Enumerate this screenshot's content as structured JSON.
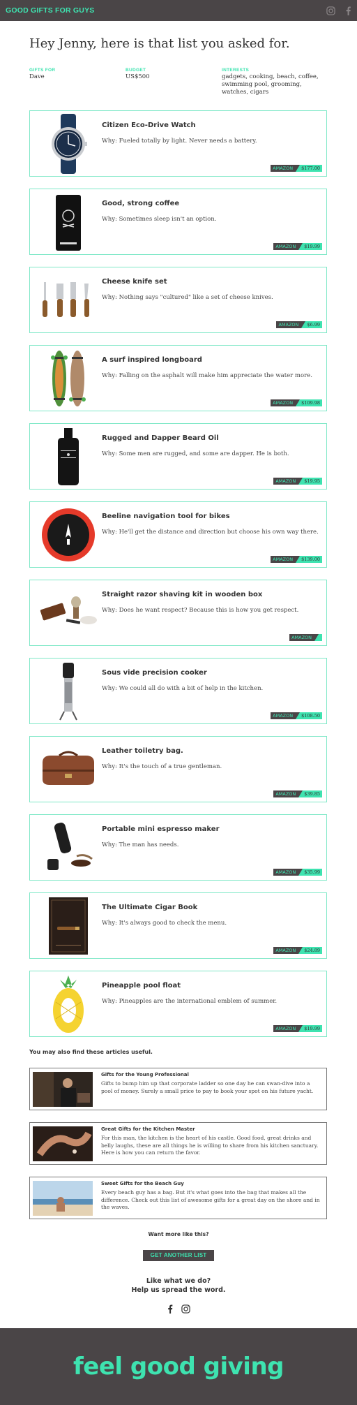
{
  "header": {
    "brand": "GOOD GIFTS FOR GUYS",
    "icons": [
      "instagram-icon",
      "facebook-icon"
    ]
  },
  "greeting": "Hey Jenny, here is that list you asked for.",
  "meta": {
    "gifts_for_label": "GIFTS FOR",
    "gifts_for_value": "Dave",
    "budget_label": "BUDGET",
    "budget_value": "US$500",
    "interests_label": "INTERESTS",
    "interests_value": "gadgets, cooking, beach, coffee, swimming pool, grooming, watches, cigars"
  },
  "items": [
    {
      "title": "Citizen Eco-Drive Watch",
      "why": "Why: Fueled totally by light. Never needs a battery.",
      "store": "AMAZON",
      "price": "$177.00"
    },
    {
      "title": "Good, strong coffee",
      "why": "Why: Sometimes sleep isn't an option.",
      "store": "AMAZON",
      "price": "$19.99"
    },
    {
      "title": "Cheese knife set",
      "why": "Why: Nothing says \"cultured\" like a set of cheese knives.",
      "store": "AMAZON",
      "price": "$6.99"
    },
    {
      "title": "A surf inspired longboard",
      "why": "Why: Falling on the asphalt will make him appreciate the water more.",
      "store": "AMAZON",
      "price": "$109.98"
    },
    {
      "title": "Rugged and Dapper Beard Oil",
      "why": "Why: Some men are rugged, and some are dapper. He is both.",
      "store": "AMAZON",
      "price": "$19.95"
    },
    {
      "title": "Beeline navigation tool for bikes",
      "why": "Why: He'll get the distance and direction but choose his own way there.",
      "store": "AMAZON",
      "price": "$139.00"
    },
    {
      "title": "Straight razor shaving kit in wooden box",
      "why": "Why: Does he want respect? Because this is how you get respect.",
      "store": "AMAZON",
      "price": ""
    },
    {
      "title": "Sous vide precision cooker",
      "why": "Why: We could all do with a bit of help in the kitchen.",
      "store": "AMAZON",
      "price": "$108.50"
    },
    {
      "title": "Leather toiletry bag.",
      "why": "Why: It's the touch of a true gentleman.",
      "store": "AMAZON",
      "price": "$39.85"
    },
    {
      "title": "Portable mini espresso maker",
      "why": "Why: The man has needs.",
      "store": "AMAZON",
      "price": "$35.99"
    },
    {
      "title": "The Ultimate Cigar Book",
      "why": "Why: It's always good to check the menu.",
      "store": "AMAZON",
      "price": "$24.89"
    },
    {
      "title": "Pineapple pool float",
      "why": "Why: Pineapples are the international emblem of summer.",
      "store": "AMAZON",
      "price": "$19.99"
    }
  ],
  "articles_heading": "You may also find these articles useful.",
  "articles": [
    {
      "title": "Gifts for the Young Professional",
      "text": "Gifts to bump him up that corporate ladder so one day he can swan-dive into a pool of money. Surely a small price to pay to book your spot on his future yacht."
    },
    {
      "title": "Great Gifts for the Kitchen Master",
      "text": "For this man, the kitchen is the heart of his castle. Good food, great drinks and belly laughs, these are all things he is willing to share from his kitchen sanctuary. Here is how you can return the favor."
    },
    {
      "title": "Sweet Gifts for the Beach Guy",
      "text": "Every beach guy has a bag. But it's what goes into the bag that makes all the difference. Check out this list of awesome gifts for a great day on the shore and in the waves."
    }
  ],
  "want_more": "Want more like this?",
  "cta_label": "GET ANOTHER LIST",
  "share_line1": "Like what we do?",
  "share_line2": "Help us spread the word.",
  "footer_tagline": "feel good giving",
  "colors": {
    "accent": "#3ee3b0",
    "dark": "#4a4547",
    "card_border": "#7fe8c7"
  }
}
